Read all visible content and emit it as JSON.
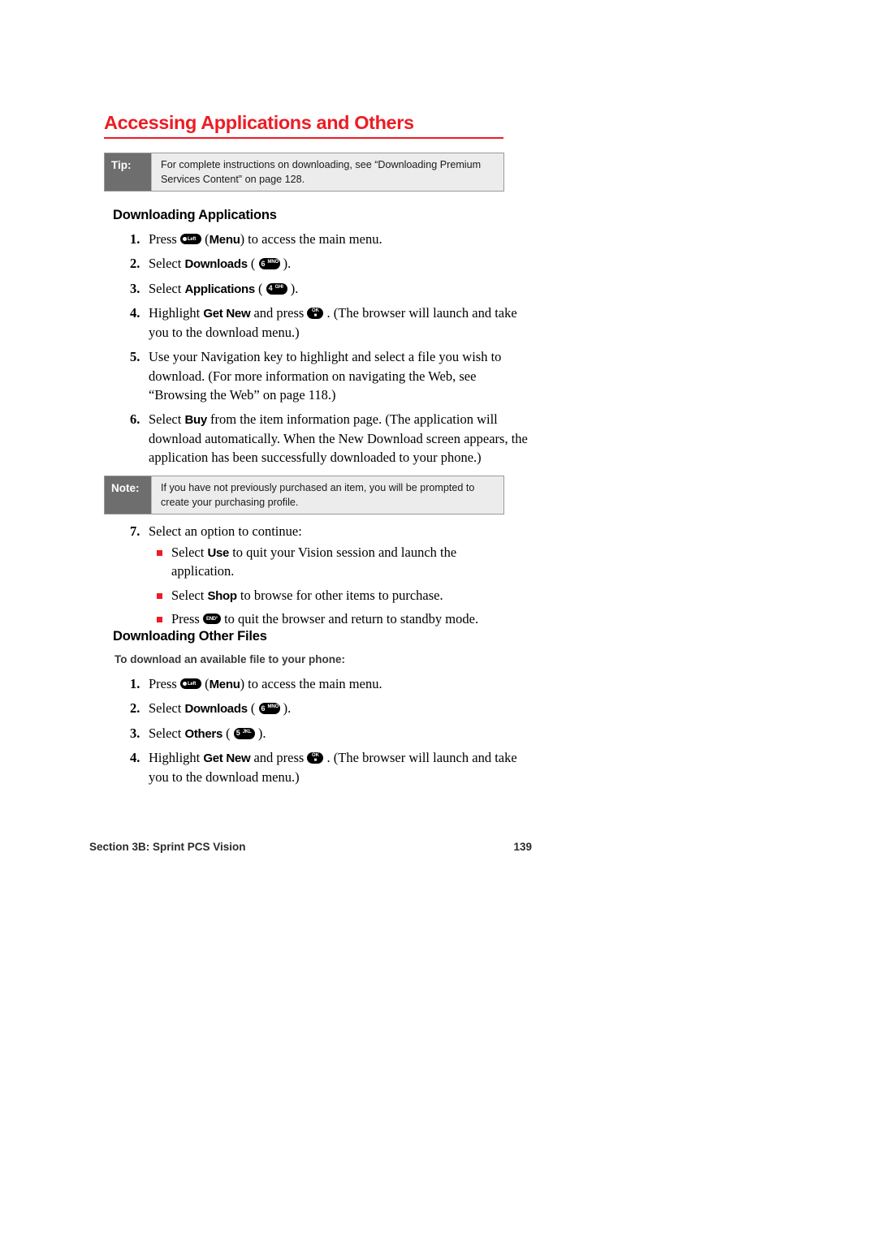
{
  "heading": {
    "title": "Accessing Applications and Others"
  },
  "tip_callout": {
    "label": "Tip:",
    "text": "For complete instructions on downloading, see “Downloading Premium Services Content” on page 128."
  },
  "note_callout": {
    "label": "Note:",
    "text": "If you have not previously purchased an item, you will be prompted to create your purchasing profile."
  },
  "section_downloading_applications": {
    "heading": "Downloading Applications",
    "steps": [
      {
        "num": "1.",
        "parts": [
          {
            "type": "text",
            "value": "Press "
          },
          {
            "type": "key-soft",
            "dot": "•",
            "label": "Left"
          },
          {
            "type": "text",
            "value": " ("
          },
          {
            "type": "bold",
            "value": "Menu"
          },
          {
            "type": "text",
            "value": ") to access the main menu."
          }
        ]
      },
      {
        "num": "2.",
        "parts": [
          {
            "type": "text",
            "value": "Select "
          },
          {
            "type": "bold",
            "value": "Downloads"
          },
          {
            "type": "text",
            "value": " ( "
          },
          {
            "type": "key-num",
            "digit": "6",
            "sub": "MNO"
          },
          {
            "type": "text",
            "value": " )."
          }
        ]
      },
      {
        "num": "3.",
        "parts": [
          {
            "type": "text",
            "value": "Select "
          },
          {
            "type": "bold",
            "value": "Applications"
          },
          {
            "type": "text",
            "value": " ( "
          },
          {
            "type": "key-num",
            "digit": "4",
            "sub": "GHI"
          },
          {
            "type": "text",
            "value": " )."
          }
        ]
      },
      {
        "num": "4.",
        "parts": [
          {
            "type": "text",
            "value": "Highlight "
          },
          {
            "type": "bold",
            "value": "Get New"
          },
          {
            "type": "text",
            "value": " and press "
          },
          {
            "type": "key-ok",
            "top": "OK",
            "bottom": "■"
          },
          {
            "type": "text",
            "value": " . (The browser will launch and take you to the download menu.)"
          }
        ]
      },
      {
        "num": "5.",
        "parts": [
          {
            "type": "text",
            "value": "Use your Navigation key to highlight and select a file you wish to download. (For more information on navigating the Web, see “Browsing the Web” on page 118.)"
          }
        ]
      },
      {
        "num": "6.",
        "parts": [
          {
            "type": "text",
            "value": "Select "
          },
          {
            "type": "bold",
            "value": "Buy"
          },
          {
            "type": "text",
            "value": " from the item information page. (The application will download automatically. When the New Download screen appears, the application has been successfully downloaded to your phone.)"
          }
        ]
      }
    ],
    "step_continue": {
      "num": "7.",
      "parts": [
        {
          "type": "text",
          "value": "Select an option to continue:"
        }
      ]
    },
    "bullets": [
      {
        "parts": [
          {
            "type": "text",
            "value": "Select "
          },
          {
            "type": "bold",
            "value": "Use"
          },
          {
            "type": "text",
            "value": " to quit your Vision session and launch the application."
          }
        ]
      },
      {
        "parts": [
          {
            "type": "text",
            "value": "Select "
          },
          {
            "type": "bold",
            "value": "Shop"
          },
          {
            "type": "text",
            "value": " to browse for other items to purchase."
          }
        ]
      },
      {
        "parts": [
          {
            "type": "text",
            "value": "Press "
          },
          {
            "type": "key-end",
            "label": "END°"
          },
          {
            "type": "text",
            "value": " to quit the browser and return to standby mode."
          }
        ]
      }
    ]
  },
  "section_downloading_other_files": {
    "heading": "Downloading Other Files",
    "sub_heading": "To download an available file to your phone:",
    "steps": [
      {
        "num": "1.",
        "parts": [
          {
            "type": "text",
            "value": "Press "
          },
          {
            "type": "key-soft",
            "dot": "•",
            "label": "Left"
          },
          {
            "type": "text",
            "value": " ("
          },
          {
            "type": "bold",
            "value": "Menu"
          },
          {
            "type": "text",
            "value": ") to access the main menu."
          }
        ]
      },
      {
        "num": "2.",
        "parts": [
          {
            "type": "text",
            "value": "Select "
          },
          {
            "type": "bold",
            "value": "Downloads"
          },
          {
            "type": "text",
            "value": " ( "
          },
          {
            "type": "key-num",
            "digit": "6",
            "sub": "MNO"
          },
          {
            "type": "text",
            "value": " )."
          }
        ]
      },
      {
        "num": "3.",
        "parts": [
          {
            "type": "text",
            "value": "Select "
          },
          {
            "type": "bold",
            "value": "Others"
          },
          {
            "type": "text",
            "value": " ( "
          },
          {
            "type": "key-num",
            "digit": "5",
            "sub": "JKL"
          },
          {
            "type": "text",
            "value": " )."
          }
        ]
      },
      {
        "num": "4.",
        "parts": [
          {
            "type": "text",
            "value": "Highlight "
          },
          {
            "type": "bold",
            "value": "Get New"
          },
          {
            "type": "text",
            "value": " and press "
          },
          {
            "type": "key-ok",
            "top": "OK",
            "bottom": "■"
          },
          {
            "type": "text",
            "value": " . (The browser will launch and take you to the download menu.)"
          }
        ]
      }
    ]
  },
  "footer": {
    "section": "Section 3B: Sprint PCS Vision",
    "page_number": "139"
  },
  "colors": {
    "accent_red": "#ED1C24",
    "callout_label_gray": "#6E6E6E",
    "callout_body_gray": "#ECECEC",
    "key_black": "#000000"
  }
}
